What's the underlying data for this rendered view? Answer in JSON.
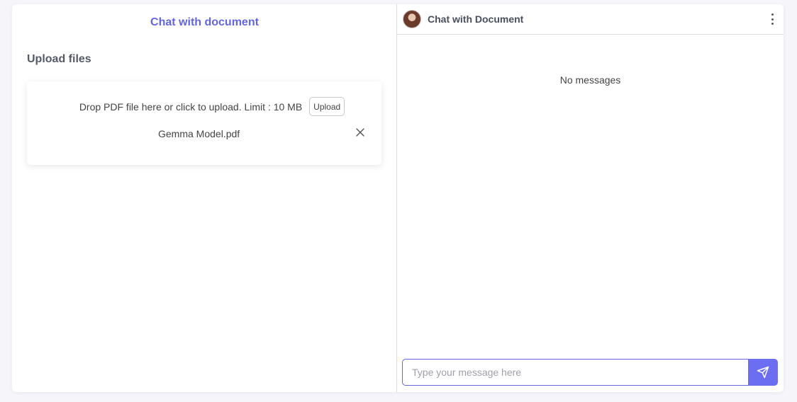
{
  "left_panel": {
    "title": "Chat with document",
    "upload_heading": "Upload files",
    "drop_text": "Drop PDF file here or click to upload. Limit : 10 MB",
    "upload_button": "Upload",
    "file_name": "Gemma Model.pdf"
  },
  "chat": {
    "title": "Chat with Document",
    "empty_text": "No messages",
    "input_placeholder": "Type your message here",
    "input_value": ""
  },
  "icons": {
    "remove_file": "close-icon",
    "menu": "more-vertical-icon",
    "send": "send-icon"
  },
  "colors": {
    "accent": "#6366e0",
    "send_button": "#6b6ef0",
    "background": "#f5f5fa"
  }
}
